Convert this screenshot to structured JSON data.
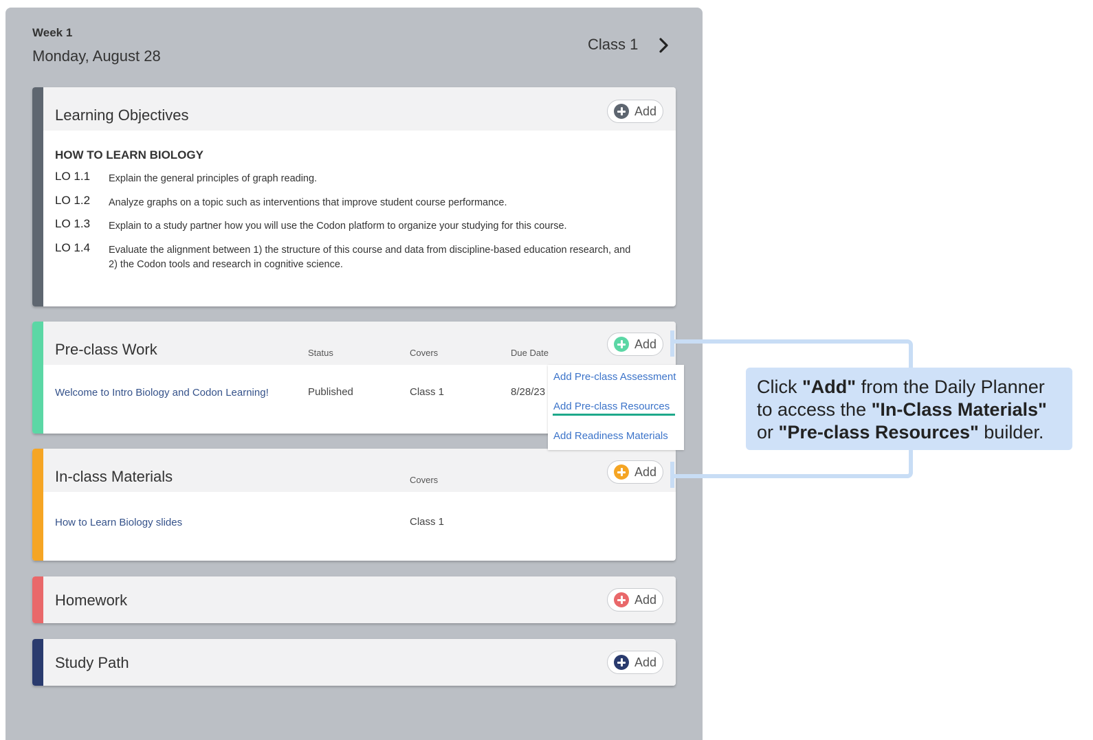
{
  "header": {
    "week": "Week 1",
    "date": "Monday, August 28",
    "class_label": "Class 1"
  },
  "learning_objectives": {
    "title": "Learning Objectives",
    "add_label": "Add",
    "heading": "HOW TO LEARN BIOLOGY",
    "items": [
      {
        "id": "LO 1.1",
        "text": "Explain the general principles of graph reading."
      },
      {
        "id": "LO 1.2",
        "text": "Analyze graphs on a topic such as interventions that improve student course performance."
      },
      {
        "id": "LO 1.3",
        "text": "Explain to a study partner how you will use the Codon platform to organize your studying for this course."
      },
      {
        "id": "LO 1.4",
        "text": "Evaluate the alignment between 1) the structure of this course and data from discipline-based education research, and 2) the Codon tools and research in cognitive science."
      }
    ]
  },
  "preclass": {
    "title": "Pre-class Work",
    "add_label": "Add",
    "columns": {
      "status": "Status",
      "covers": "Covers",
      "due": "Due Date"
    },
    "rows": [
      {
        "name": "Welcome to Intro Biology and Codon Learning!",
        "status": "Published",
        "covers": "Class 1",
        "due": "8/28/23"
      }
    ],
    "menu": [
      "Add Pre-class Assessment",
      "Add Pre-class Resources",
      "Add Readiness Materials"
    ]
  },
  "inclass": {
    "title": "In-class Materials",
    "add_label": "Add",
    "columns": {
      "covers": "Covers"
    },
    "rows": [
      {
        "name": "How to Learn Biology slides",
        "covers": "Class 1"
      }
    ]
  },
  "homework": {
    "title": "Homework",
    "add_label": "Add"
  },
  "studypath": {
    "title": "Study Path",
    "add_label": "Add"
  },
  "callout": {
    "p1": "Click ",
    "b1": "\"Add\"",
    "p2": " from the Daily Planner to access the ",
    "b2": "\"In-Class Materials\"",
    "p3": " or ",
    "b3": "\"Pre-class Resources\"",
    "p4": " builder."
  },
  "colors": {
    "objectives": "#5e6670",
    "preclass": "#5bd7a5",
    "inclass": "#f5a524",
    "homework": "#e9686a",
    "studypath": "#2a3b6e"
  }
}
